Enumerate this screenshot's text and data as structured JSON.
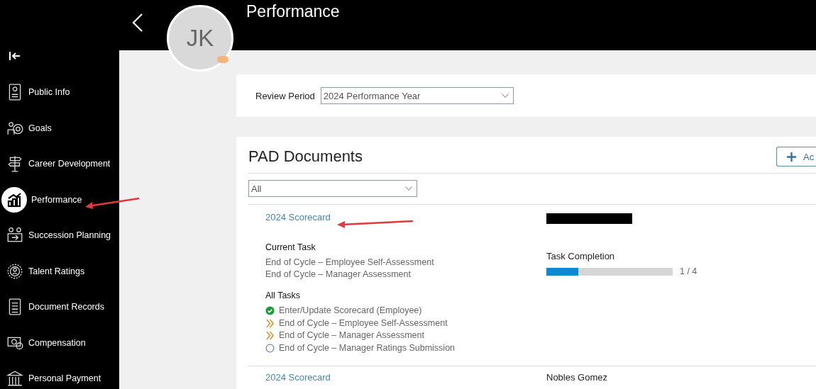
{
  "header": {
    "title": "Performance",
    "avatar_initials": "JK"
  },
  "sidebar": {
    "items": [
      {
        "label": "Public Info",
        "selected": false
      },
      {
        "label": "Goals",
        "selected": false
      },
      {
        "label": "Career Development",
        "selected": false
      },
      {
        "label": "Performance",
        "selected": true
      },
      {
        "label": "Succession Planning",
        "selected": false
      },
      {
        "label": "Talent Ratings",
        "selected": false
      },
      {
        "label": "Document Records",
        "selected": false
      },
      {
        "label": "Compensation",
        "selected": false
      },
      {
        "label": "Personal Payment",
        "selected": false
      }
    ]
  },
  "review_period": {
    "label": "Review Period",
    "value": "2024 Performance Year"
  },
  "pad_documents": {
    "title": "PAD Documents",
    "add_button": "Ac",
    "filter": "All",
    "documents": [
      {
        "title": "2024 Scorecard",
        "owner_redacted": true,
        "current_task_label": "Current Task",
        "current_tasks": [
          "End of Cycle – Employee Self-Assessment",
          "End of Cycle – Manager Assessment"
        ],
        "completion_label": "Task Completion",
        "completion": {
          "level": 0.25,
          "reading": "1 / 4"
        },
        "all_tasks_label": "All Tasks",
        "tasks": [
          {
            "label": "Enter/Update Scorecard (Employee)",
            "kind": "done"
          },
          {
            "label": "End of Cycle – Employee Self-Assessment",
            "kind": "current"
          },
          {
            "label": "End of Cycle – Manager Assessment",
            "kind": "current"
          },
          {
            "label": "End of Cycle – Manager Ratings Submission",
            "kind": "pending"
          }
        ]
      },
      {
        "title": "2024 Scorecard",
        "owner": "Nobles Gomez"
      }
    ]
  }
}
